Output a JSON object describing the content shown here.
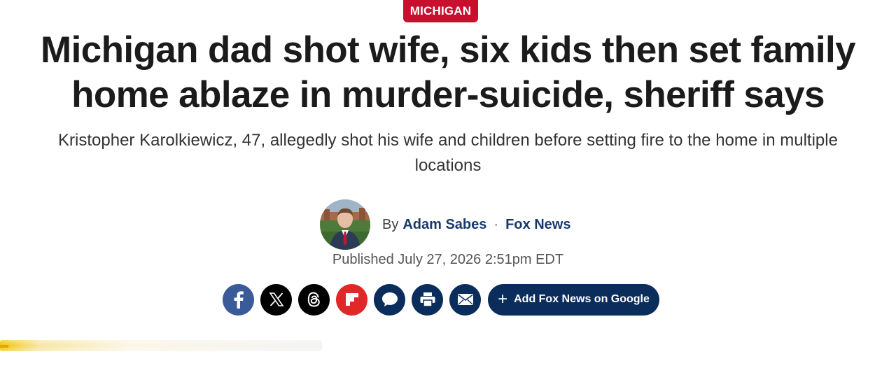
{
  "category": {
    "label": "MICHIGAN"
  },
  "article": {
    "headline_line1": "Michigan dad shot wife, six kids then set family",
    "headline_line2": "home ablaze in murder-suicide, sheriff says",
    "subheadline": "Kristopher Karolkiewicz, 47, allegedly shot his wife and children before setting fire to the home in multiple locations",
    "byline_prefix": "By",
    "author": "Adam Sabes",
    "separator": "·",
    "outlet": "Fox News",
    "published": "Published July 27, 2026 2:51pm EDT"
  },
  "share": {
    "icons": [
      "facebook-icon",
      "x-icon",
      "threads-icon",
      "flipboard-icon",
      "comments-icon",
      "print-icon",
      "email-icon"
    ],
    "google_button_label": "Add Fox News on Google",
    "google_button_icon": "plus-icon"
  },
  "colors": {
    "category_red": "#c8102e",
    "fox_navy": "#0b2d5b",
    "facebook_blue": "#3b5a9a",
    "flipboard_red": "#e12828",
    "byline_blue": "#183a6b"
  }
}
